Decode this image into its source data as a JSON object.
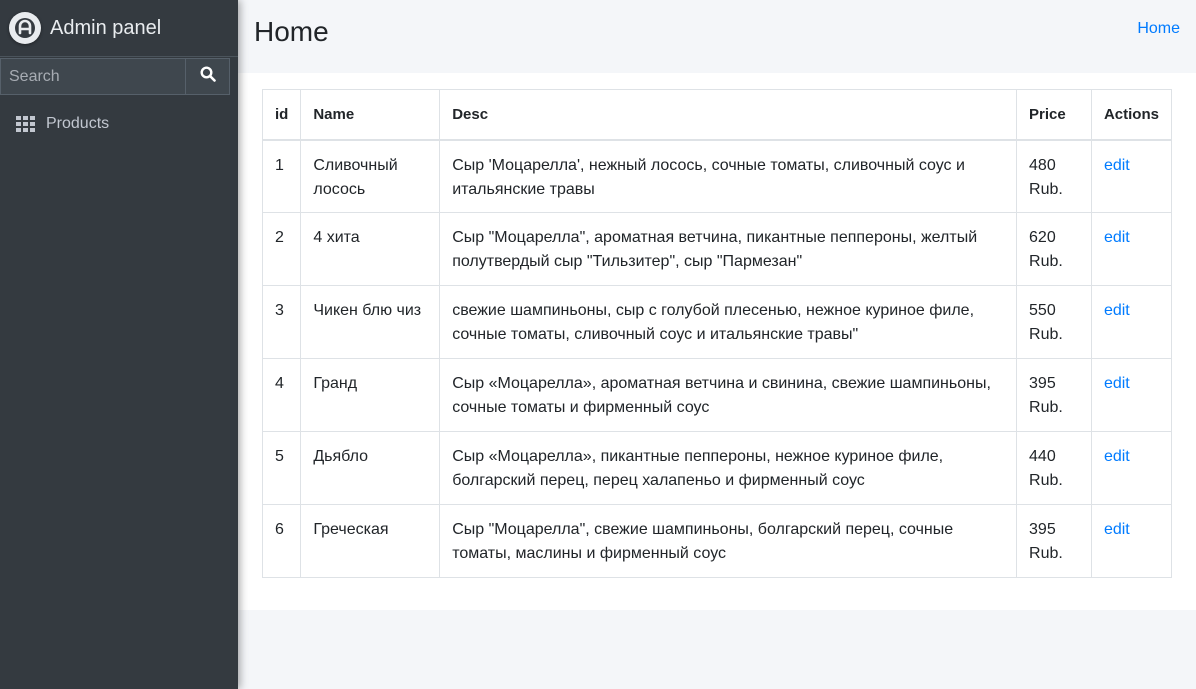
{
  "sidebar": {
    "brand": "Admin panel",
    "search_placeholder": "Search",
    "nav": [
      {
        "label": "Products"
      }
    ]
  },
  "header": {
    "title": "Home",
    "breadcrumb": "Home"
  },
  "table": {
    "columns": [
      "id",
      "Name",
      "Desc",
      "Price",
      "Actions"
    ],
    "rows": [
      {
        "id": "1",
        "name": "Сливочный лосось",
        "desc": "Сыр 'Моцарелла', нежный лосось, сочные томаты, сливочный соус и итальянские травы",
        "price": "480 Rub.",
        "action": "edit"
      },
      {
        "id": "2",
        "name": "4 хита",
        "desc": "Сыр \"Моцарелла\", ароматная ветчина, пикантные пеппероны, желтый полутвердый сыр \"Тильзитер\", сыр \"Пармезан\"",
        "price": "620 Rub.",
        "action": "edit"
      },
      {
        "id": "3",
        "name": "Чикен блю чиз",
        "desc": "свежие шампиньоны, сыр с голубой плесенью, нежное куриное филе, сочные томаты, сливочный соус и итальянские травы\"",
        "price": "550 Rub.",
        "action": "edit"
      },
      {
        "id": "4",
        "name": "Гранд",
        "desc": "Сыр «Моцарелла», ароматная ветчина и свинина, свежие шампиньоны, сочные томаты и фирменный соус",
        "price": "395 Rub.",
        "action": "edit"
      },
      {
        "id": "5",
        "name": "Дьябло",
        "desc": "Сыр «Моцарелла», пикантные пеппероны, нежное куриное филе, болгарский перец, перец халапеньо и фирменный соус",
        "price": "440 Rub.",
        "action": "edit"
      },
      {
        "id": "6",
        "name": "Греческая",
        "desc": "Сыр \"Моцарелла\", свежие шампиньоны, болгарский перец, сочные томаты, маслины и фирменный соус",
        "price": "395 Rub.",
        "action": "edit"
      }
    ]
  },
  "colors": {
    "sidebar_bg": "#343a40",
    "link": "#007bff",
    "page_bg": "#f4f6f9"
  },
  "icons": {
    "brand": "admin-logo-icon",
    "search": "search-icon",
    "products": "grid-icon"
  }
}
